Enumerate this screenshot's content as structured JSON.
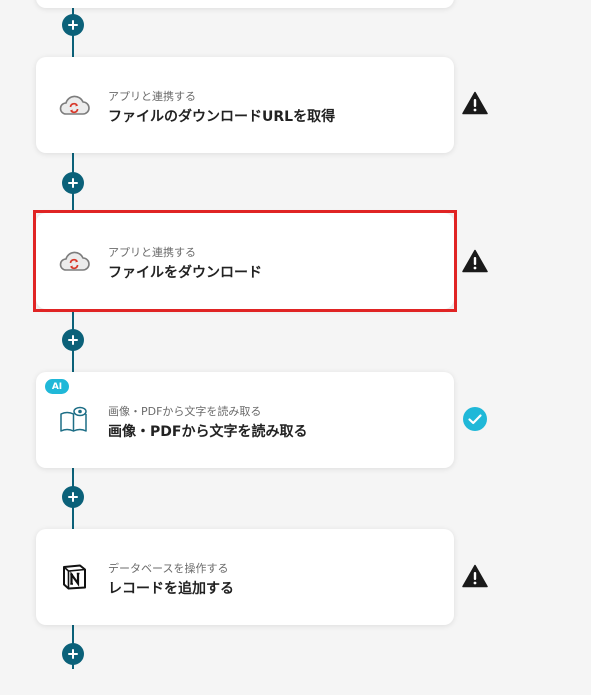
{
  "colors": {
    "connector": "#0b6179",
    "warning": "#1a1a1a",
    "success": "#20b8d8",
    "selected_outline": "#e02424",
    "ai_badge": "#20b8d8"
  },
  "steps": [
    {
      "icon": "cloud-sync-icon",
      "subtitle": "アプリと連携する",
      "title": "ファイルのダウンロードURLを取得",
      "status": "warning-icon"
    },
    {
      "icon": "cloud-sync-icon",
      "subtitle": "アプリと連携する",
      "title": "ファイルをダウンロード",
      "status": "warning-icon",
      "selected": true
    },
    {
      "icon": "book-eye-icon",
      "badge": "AI",
      "subtitle": "画像・PDFから文字を読み取る",
      "title": "画像・PDFから文字を読み取る",
      "status": "check-circle-icon"
    },
    {
      "icon": "notion-icon",
      "subtitle": "データベースを操作する",
      "title": "レコードを追加する",
      "status": "warning-icon"
    }
  ],
  "add_buttons": [
    "plus-icon",
    "plus-icon",
    "plus-icon",
    "plus-icon",
    "plus-icon"
  ]
}
